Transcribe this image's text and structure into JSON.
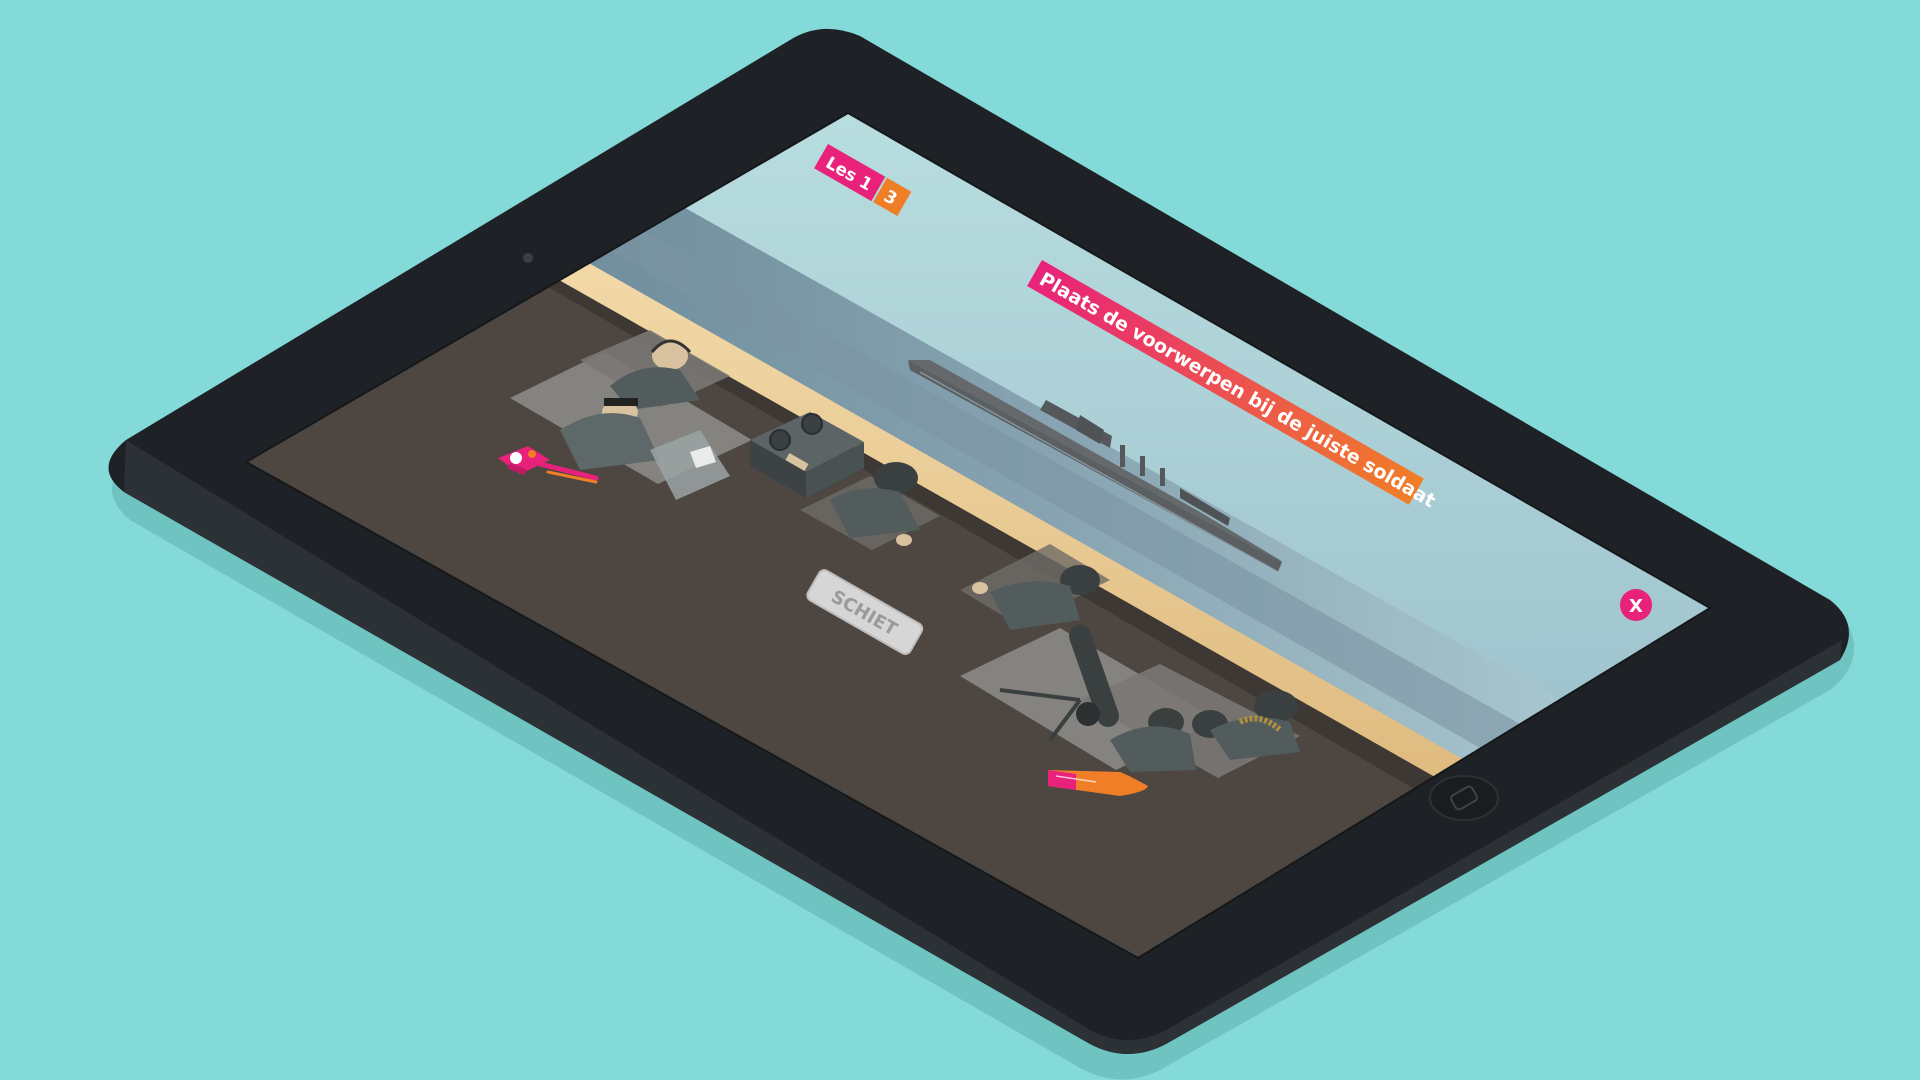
{
  "lesson": {
    "label": "Les 1",
    "step": "3"
  },
  "instruction": {
    "text": "Plaats de voorwerpen bij de juiste soldaat"
  },
  "controls": {
    "fire_label": "SCHIET",
    "close_label": "X"
  },
  "items": [
    {
      "name": "rangefinder-tool",
      "icon": "rangefinder-icon"
    },
    {
      "name": "artillery-shell",
      "icon": "shell-icon"
    }
  ],
  "colors": {
    "background": "#84dad8",
    "tablet_body": "#1e2226",
    "accent_pink": "#e8227a",
    "accent_orange": "#f07e27",
    "bunker_floor": "#4d4641",
    "sky": "#b3dadc",
    "sea": "#7e98a3",
    "sand": "#eccf9c"
  }
}
